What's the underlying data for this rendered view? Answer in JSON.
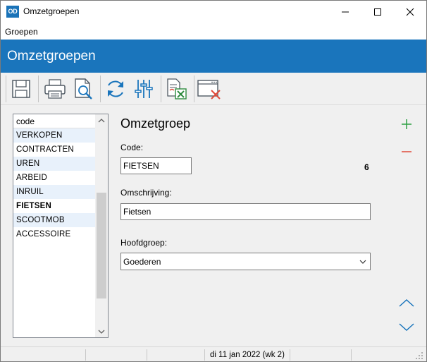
{
  "window": {
    "title": "Omzetgroepen",
    "icon_text": "OD"
  },
  "menu": {
    "items": [
      {
        "label": "Groepen"
      }
    ]
  },
  "header": {
    "title": "Omzetgroepen",
    "color": "#1a75bc"
  },
  "toolbar": {
    "buttons": [
      {
        "icon": "save-icon"
      },
      {
        "icon": "print-icon"
      },
      {
        "icon": "print-preview-icon"
      },
      {
        "icon": "refresh-icon"
      },
      {
        "icon": "settings-sliders-icon"
      },
      {
        "icon": "export-excel-icon"
      },
      {
        "icon": "close-window-icon"
      }
    ]
  },
  "list": {
    "header": "code",
    "items": [
      "VERKOPEN",
      "CONTRACTEN",
      "UREN",
      "ARBEID",
      "INRUIL",
      "FIETSEN",
      "SCOOTMOB",
      "ACCESSOIRE"
    ],
    "selected": "FIETSEN"
  },
  "form": {
    "title": "Omzetgroep",
    "code_label": "Code:",
    "code_value": "FIETSEN",
    "count": "6",
    "description_label": "Omschrijving:",
    "description_value": "Fietsen",
    "maingroup_label": "Hoofdgroep:",
    "maingroup_value": "Goederen"
  },
  "side_buttons": {
    "add": "add-icon",
    "remove": "remove-icon",
    "up": "chevron-up-icon",
    "down": "chevron-down-icon",
    "add_color": "#2ea043",
    "remove_color": "#e04a3a"
  },
  "status": {
    "date": "di 11 jan 2022 (wk 2)"
  }
}
